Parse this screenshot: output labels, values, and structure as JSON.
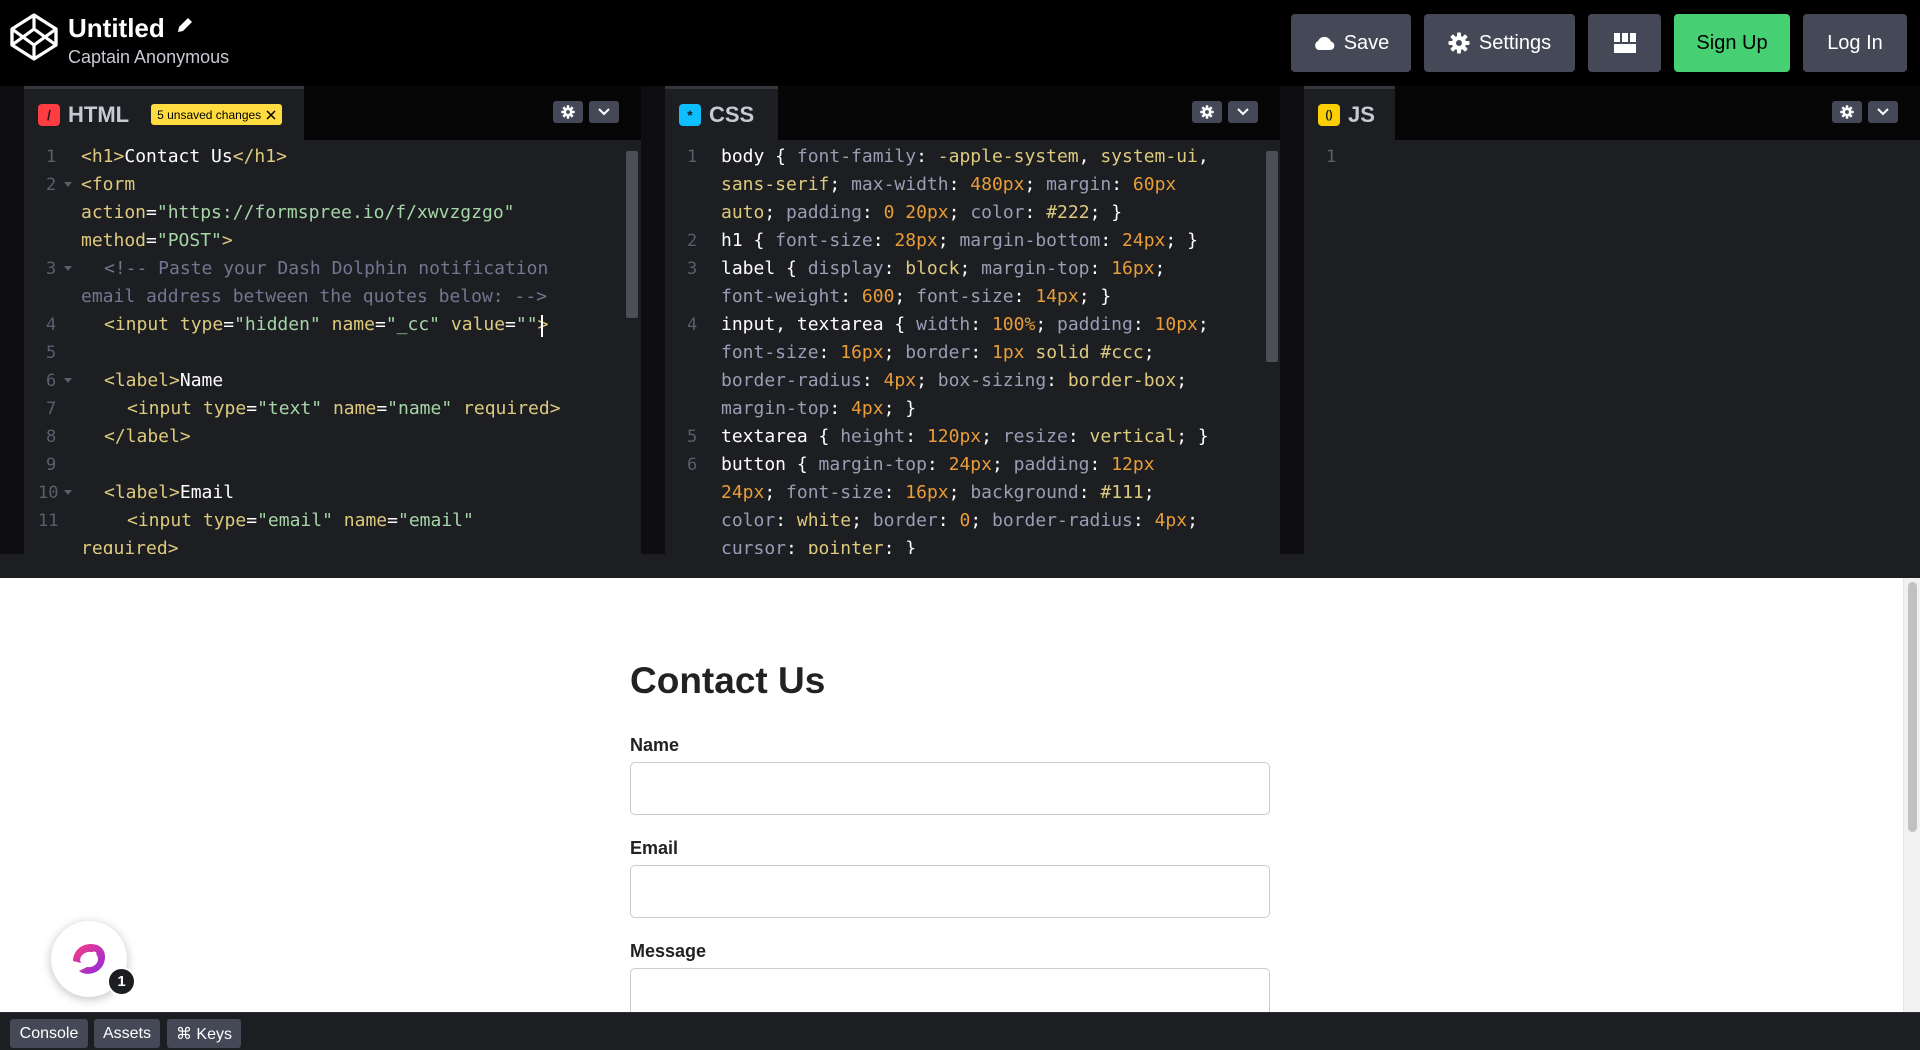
{
  "header": {
    "title": "Untitled",
    "author": "Captain Anonymous",
    "buttons": {
      "save": "Save",
      "settings": "Settings",
      "signup": "Sign Up",
      "login": "Log In"
    }
  },
  "editors": {
    "html": {
      "name": "HTML",
      "badge_glyph": "/",
      "badge_color": "#ff3c41",
      "unsaved": "5 unsaved changes",
      "line_numbers": [
        "1",
        "2",
        "",
        "",
        "3",
        "",
        "4",
        "5",
        "6",
        "7",
        "8",
        "9",
        "10",
        "11"
      ]
    },
    "css": {
      "name": "CSS",
      "badge_glyph": "*",
      "badge_color": "#0ebeff",
      "line_numbers": [
        "1",
        "",
        "",
        "2",
        "3",
        "",
        "4",
        "",
        "",
        "",
        "5",
        "6"
      ]
    },
    "js": {
      "name": "JS",
      "badge_glyph": "()",
      "badge_color": "#fcd000",
      "line_numbers": [
        "1"
      ]
    }
  },
  "preview": {
    "title": "Contact Us",
    "labels": {
      "name": "Name",
      "email": "Email",
      "message": "Message"
    }
  },
  "bubble": {
    "count": "1"
  },
  "footer": {
    "console": "Console",
    "assets": "Assets",
    "keys": "⌘ Keys"
  },
  "colors": {
    "accent_green": "#47cf73",
    "unsaved_yellow": "#ffdd40",
    "button_gray": "#444857",
    "editor_bg": "#1d1e22"
  }
}
